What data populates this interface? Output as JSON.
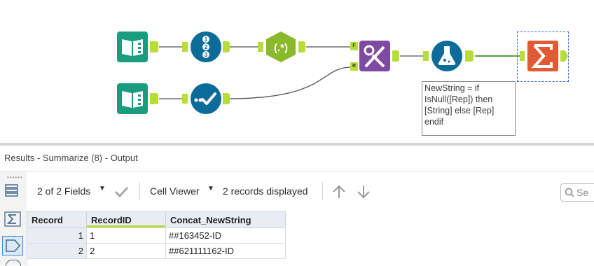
{
  "colors": {
    "input_tool": "#1a9c7f",
    "recordid_tool": "#0c6c99",
    "regex_tool": "#8ab92a",
    "join_tool": "#7f4ba0",
    "formula_tool": "#0c6c99",
    "summarize_tool": "#e05a34",
    "anchor": "#b8dd3a",
    "connector": "#555555",
    "selected_connector": "#47a84a"
  },
  "workflow": {
    "tools": [
      {
        "name": "input-data-1",
        "icon": "book-icon"
      },
      {
        "name": "record-id",
        "icon": "numbered-list-icon"
      },
      {
        "name": "regex",
        "icon": "regex-icon",
        "label": "(.*)"
      },
      {
        "name": "input-data-2",
        "icon": "book-icon"
      },
      {
        "name": "select",
        "icon": "checkmark-icon"
      },
      {
        "name": "join",
        "icon": "join-icon",
        "anchor_f": "F",
        "anchor_r": "R"
      },
      {
        "name": "formula",
        "icon": "flask-icon"
      },
      {
        "name": "summarize",
        "icon": "sigma-icon",
        "symbol": "Σ"
      }
    ],
    "annotation": "NewString = if\nIsNull([Rep]) then\n[String] else [Rep]\nendif"
  },
  "results": {
    "title": "Results - Summarize (8) - Output",
    "fields_label": "2 of 2 Fields",
    "cell_viewer_label": "Cell Viewer",
    "records_label": "2 records displayed",
    "search_placeholder": "Se",
    "columns": [
      "Record",
      "RecordID",
      "Concat_NewString"
    ],
    "rows": [
      {
        "record": "1",
        "recordid": "1",
        "concat": "##163452-ID"
      },
      {
        "record": "2",
        "recordid": "2",
        "concat": "##621111162-ID"
      }
    ]
  }
}
